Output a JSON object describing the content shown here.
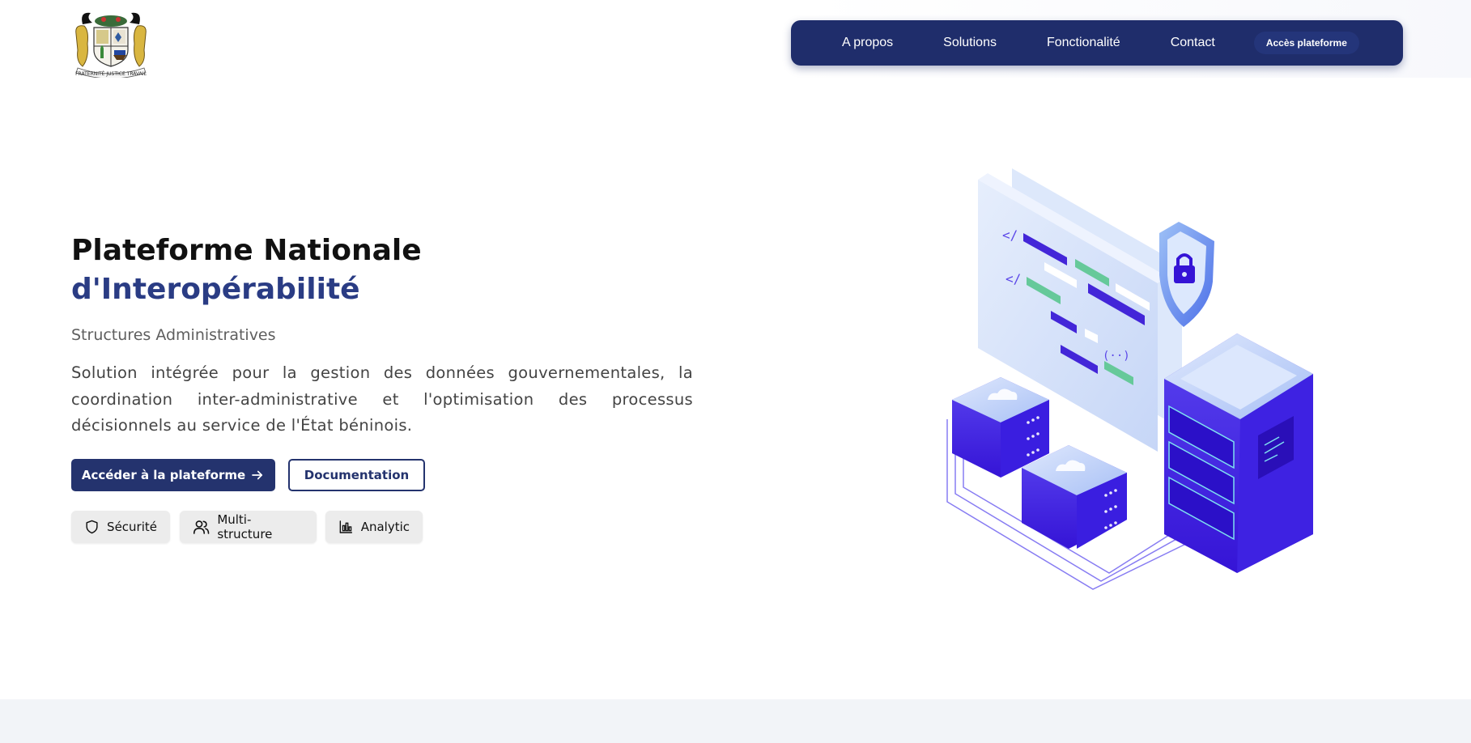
{
  "header": {
    "logo_name": "benin-coat-of-arms",
    "logo_motto": "FRATERNITÉ JUSTICE TRAVAIL",
    "nav": {
      "items": [
        "A propos",
        "Solutions",
        "Fonctionalité",
        "Contact"
      ],
      "cta_label": "Accès plateforme"
    }
  },
  "hero": {
    "title_line1": "Plateforme Nationale",
    "title_line2": "d'Interopérabilité",
    "subtitle": "Structures Administratives",
    "description": "Solution intégrée pour la gestion des données gouvernementales, la coordination inter-administrative et l'optimisation des processus décisionnels au service de l'État béninois.",
    "primary_button": "Accéder à la plateforme",
    "secondary_button": "Documentation",
    "features": [
      {
        "label": "Sécurité",
        "icon": "shield-icon"
      },
      {
        "label": "Multi-structure",
        "icon": "users-icon"
      },
      {
        "label": "Analytic",
        "icon": "bar-chart-icon"
      }
    ]
  },
  "colors": {
    "brand": "#1f2d6b",
    "accent": "#2a3c84",
    "illustration_primary": "#4a2fe0"
  }
}
